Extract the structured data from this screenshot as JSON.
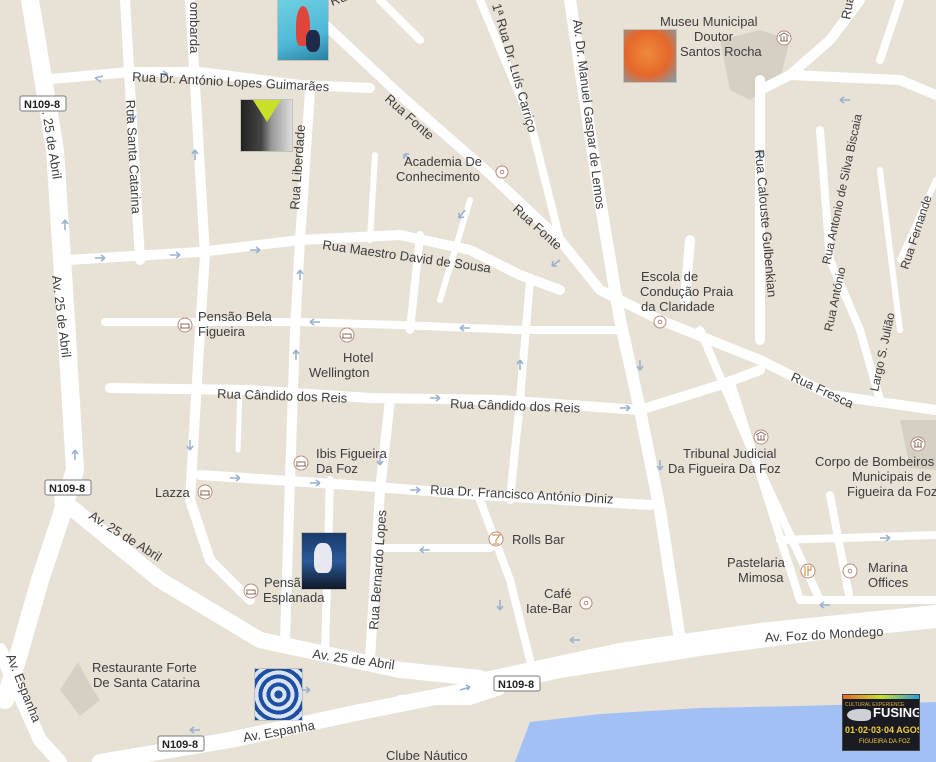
{
  "map": {
    "streets": {
      "rua_ldf": "Rua Dr. António Lopes Guimarães",
      "rua_fonte_1": "Rua Fonte",
      "rua_fonte_2": "Rua Fonte",
      "rua_maestro": "Rua Maestro David de Sousa",
      "rua_candido_1": "Rua Cândido dos Reis",
      "rua_candido_2": "Rua Cândido dos Reis",
      "rua_francisco": "Rua Dr. Francisco António Diniz",
      "rua_fresca": "Rua Fresca",
      "av25_1": "Av. 25 de Abril",
      "av25_2": "Av. 25 de Abril",
      "av25_3": "Av. 25 de Abril",
      "av25_4": "Av. 25 de Abril",
      "av_espanha_1": "Av. Espanha",
      "av_espanha_2": "Av. Espanha",
      "av_foz": "Av. Foz do Mondego",
      "rua_santa_catarina": "Rua Santa Catarina",
      "rua_liberdade": "Rua Liberdade",
      "rua_bernardo": "Rua Bernardo Lopes",
      "rua_manuel": "Av. Dr. Manuel Gaspar de Lemos",
      "rua_luis": "1ª Rua Dr. Luís Carriço",
      "rua_calouste": "Rua Calouste Gulbenkian",
      "rua_silva": "Rua Antonio de Silva Biscaia",
      "rua_antonio": "Rua António",
      "largo_julio": "Largo S. Julião",
      "rua_fernande": "Rua Fernande",
      "lombarda": "ombarda",
      "rua_top": "Rua",
      "rua_r": "Rua"
    },
    "road_shields": [
      "N109-8",
      "N109-8",
      "N109-8",
      "N109-8"
    ],
    "pois": {
      "museu_1": "Museu Municipal",
      "museu_2": "Doutor",
      "museu_3": "Santos Rocha",
      "academia_1": "Academia De",
      "academia_2": "Conhecimento",
      "escola_1": "Escola de",
      "escola_2": "Condução Praia",
      "escola_3": "da Claridade",
      "pensao_bela_1": "Pensão Bela",
      "pensao_bela_2": "Figueira",
      "hotel_1": "Hotel",
      "hotel_2": "Wellington",
      "ibis_1": "Ibis Figueira",
      "ibis_2": "Da Foz",
      "lazza": "Lazza",
      "rolls": "Rolls Bar",
      "cafe_1": "Café",
      "cafe_2": "Iate-Bar",
      "tribunal_1": "Tribunal Judicial",
      "tribunal_2": "Da Figueira Da Foz",
      "bombeiros_1": "Corpo de Bombeiros",
      "bombeiros_2": "Municipais de",
      "bombeiros_3": "Figueira da Foz",
      "pastelaria_1": "Pastelaria",
      "pastelaria_2": "Mimosa",
      "marina_1": "Marina",
      "marina_2": "Offices",
      "pensao_esp_1": "Pensã",
      "pensao_esp_2": "Esplanada",
      "restaurante_1": "Restaurante Forte",
      "restaurante_2": "De Santa Catarina",
      "clube": "Clube Náutico"
    },
    "logo": {
      "small_text": "CULTURAL EXPERIENCE",
      "name": "FUSING",
      "dates": "01·02·03·04 AGOSTO",
      "place": "FIGUEIRA DA FOZ"
    },
    "colors": {
      "land": "#e8e1d6",
      "road": "#ffffff",
      "water": "#a3c0f5",
      "arrow": "#9ab2cf"
    }
  }
}
